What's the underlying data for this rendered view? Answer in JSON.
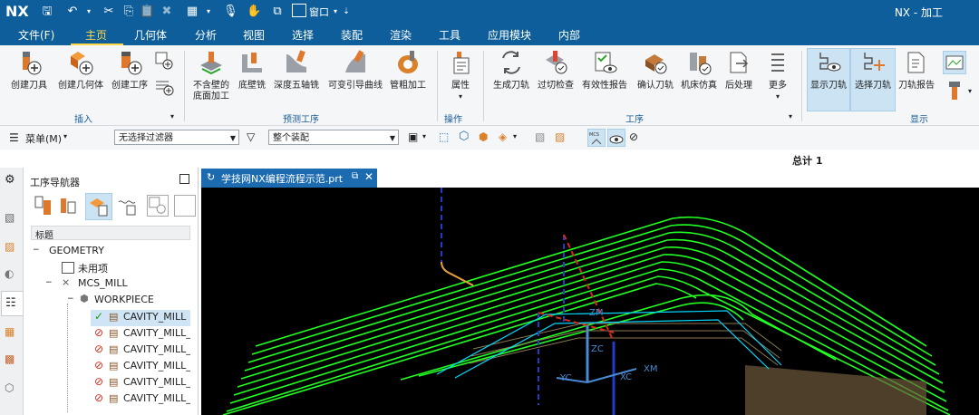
{
  "app": {
    "logo": "NX",
    "title": "NX - 加工",
    "window_menu": "窗口"
  },
  "menu_tabs": [
    "文件(F)",
    "主页",
    "几何体",
    "分析",
    "视图",
    "选择",
    "装配",
    "渲染",
    "工具",
    "应用模块",
    "内部"
  ],
  "active_tab": "主页",
  "ribbon": {
    "insert": {
      "group": "插入",
      "buttons": [
        "创建刀具",
        "创建几何体",
        "创建工序"
      ]
    },
    "predict": {
      "group": "预测工序",
      "buttons": [
        "不含壁的",
        "底面加工",
        "底壁铣",
        "深度五轴铣",
        "可变引导曲线",
        "管粗加工"
      ]
    },
    "operation": {
      "group": "操作",
      "buttons": [
        "属性"
      ]
    },
    "process": {
      "group": "工序",
      "buttons": [
        "生成刀轨",
        "过切检查",
        "有效性报告",
        "确认刀轨",
        "机床仿真",
        "后处理",
        "更多"
      ]
    },
    "display": {
      "group": "显示",
      "buttons": [
        "显示刀轨",
        "选择刀轨",
        "刀轨报告"
      ]
    }
  },
  "filterbar": {
    "menu_label": "菜单(M)",
    "filter_value": "无选择过滤器",
    "assembly_value": "整个装配"
  },
  "status": {
    "total": "总计 1"
  },
  "navigator": {
    "title": "工序导航器",
    "column_header": "标题",
    "tree": [
      {
        "label": "GEOMETRY",
        "state": "none"
      },
      {
        "label": "未用项",
        "state": "none"
      },
      {
        "label": "MCS_MILL",
        "state": "none"
      },
      {
        "label": "WORKPIECE",
        "state": "none"
      },
      {
        "label": "CAVITY_MILL",
        "state": "ok"
      },
      {
        "label": "CAVITY_MILL_",
        "state": "regen"
      },
      {
        "label": "CAVITY_MILL_",
        "state": "regen"
      },
      {
        "label": "CAVITY_MILL_",
        "state": "regen"
      },
      {
        "label": "CAVITY_MILL_",
        "state": "regen"
      },
      {
        "label": "CAVITY_MILL_",
        "state": "regen"
      }
    ]
  },
  "document": {
    "tab_label": "学技网NX编程流程示范.prt"
  },
  "viewport": {
    "axis_labels": [
      "ZM",
      "ZC",
      "XM",
      "YC",
      "XC"
    ]
  },
  "colors": {
    "brand": "#0d5e9a",
    "active_tab": "#ffd84a",
    "toolpath": "#22ff22",
    "viewport_bg": "#000000"
  }
}
